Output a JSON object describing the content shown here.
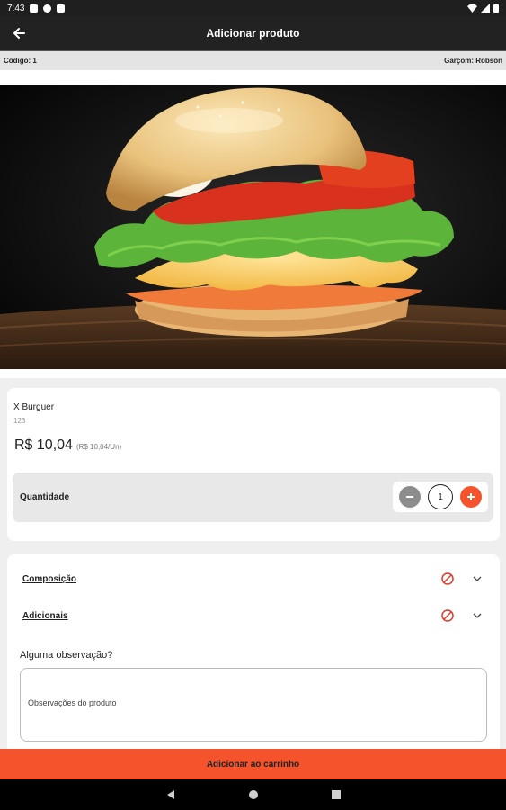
{
  "status_bar": {
    "time": "7:43"
  },
  "app_bar": {
    "title": "Adicionar produto"
  },
  "info": {
    "code": "Código: 1",
    "waiter": "Garçom: Robson"
  },
  "product": {
    "name": "X Burguer",
    "code": "123",
    "price": "R$ 10,04",
    "unit_price": "(R$ 10,04/Un)"
  },
  "quantity": {
    "label": "Quantidade",
    "value": "1"
  },
  "options": [
    {
      "label": "Composição"
    },
    {
      "label": "Adicionais"
    }
  ],
  "observation": {
    "label": "Alguma observação?",
    "placeholder": "Observações do produto"
  },
  "cta": {
    "label": "Adicionar ao carrinho"
  },
  "icons": {
    "back": "arrow-left-icon",
    "minus": "minus-icon",
    "plus": "plus-icon",
    "ban": "ban-icon",
    "chevron": "chevron-down-icon"
  },
  "colors": {
    "accent": "#f4532c",
    "app_bar": "#222222",
    "minus": "#8d8d8d"
  }
}
